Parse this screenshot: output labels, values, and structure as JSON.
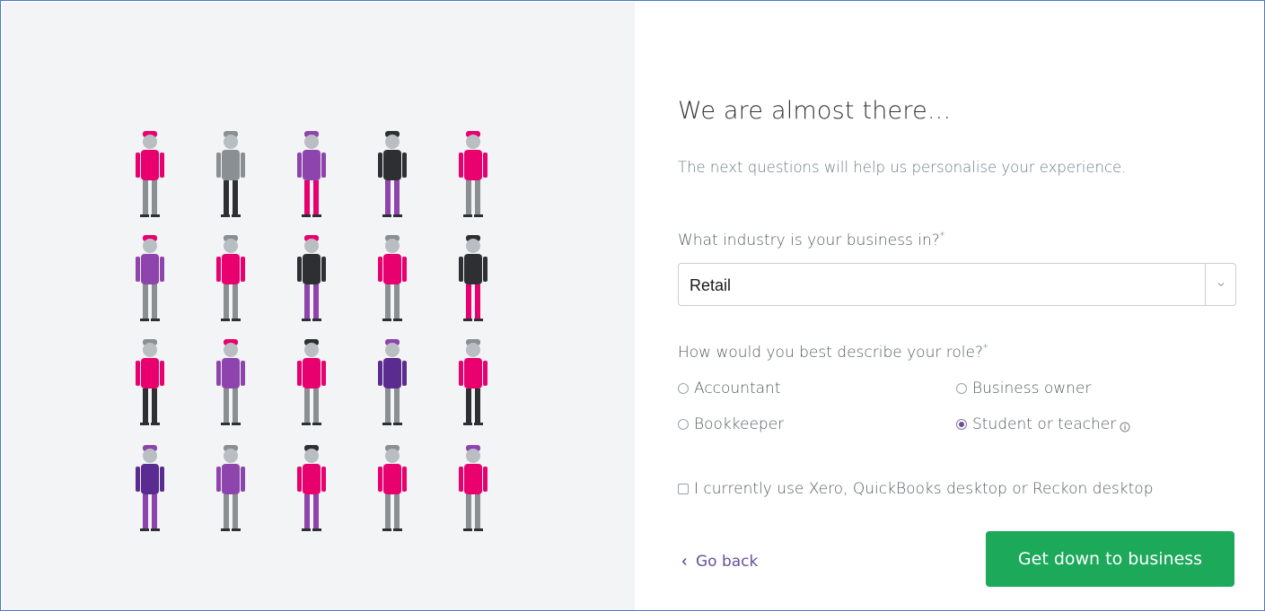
{
  "onboarding": {
    "title": "We are almost there...",
    "subtitle": "The next questions will help us personalise your experience."
  },
  "industry": {
    "label": "What industry is your business in?",
    "required_marker": "*",
    "selected": "Retail"
  },
  "role": {
    "label": "How would you best describe your role?",
    "required_marker": "*",
    "options": [
      {
        "label": "Accountant",
        "checked": false
      },
      {
        "label": "Business owner",
        "checked": false
      },
      {
        "label": "Bookkeeper",
        "checked": false
      },
      {
        "label": "Student or teacher",
        "checked": true
      }
    ]
  },
  "migration": {
    "label": "I currently use Xero, QuickBooks desktop or Reckon desktop",
    "checked": false
  },
  "actions": {
    "back_label": "Go back",
    "submit_label": "Get down to business"
  },
  "illustration": {
    "icon": "people-illustration",
    "colors": {
      "magenta": "#e8006e",
      "purple": "#8e44ad",
      "dark_purple": "#5b2c8f",
      "grey": "#8a8f94",
      "dark": "#2d2f33"
    }
  },
  "colors": {
    "primary_button": "#1ca95a",
    "link": "#6b4f9c",
    "left_panel": "#f3f4f6"
  }
}
